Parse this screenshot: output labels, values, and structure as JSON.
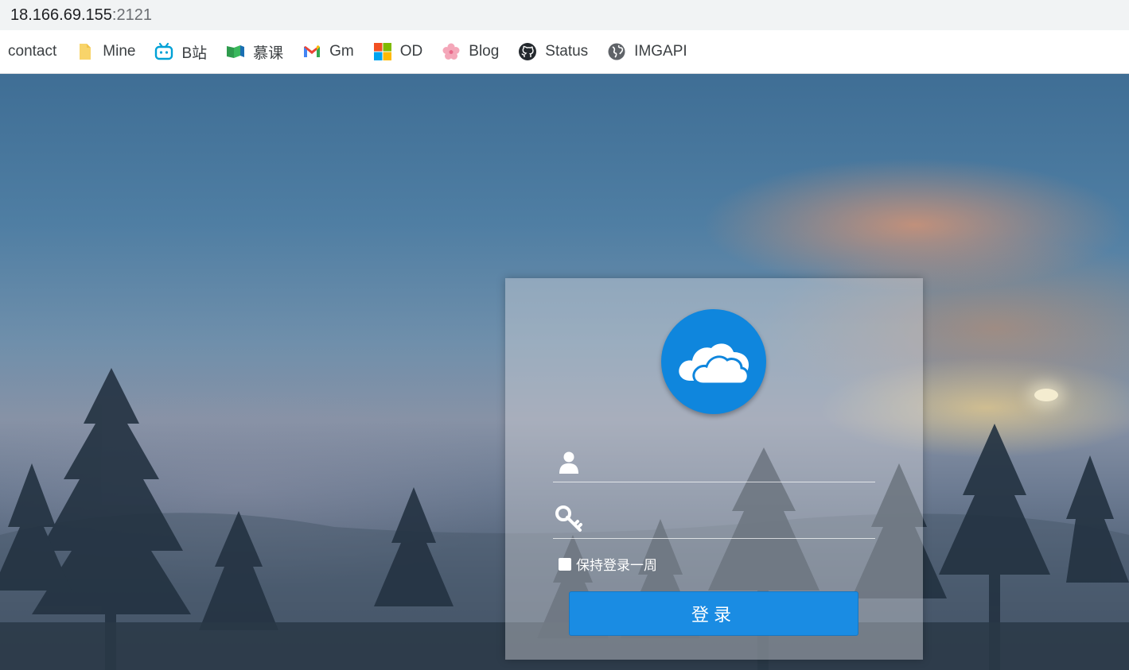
{
  "address": {
    "host": "18.166.69.155",
    "port": ":2121"
  },
  "bookmarks": [
    {
      "label": "contact",
      "icon": "none"
    },
    {
      "label": "Mine",
      "icon": "folder-icon"
    },
    {
      "label": "B站",
      "icon": "bilibili-icon"
    },
    {
      "label": "慕课",
      "icon": "book-icon"
    },
    {
      "label": "Gm",
      "icon": "gmail-icon"
    },
    {
      "label": "OD",
      "icon": "microsoft-icon"
    },
    {
      "label": "Blog",
      "icon": "flower-icon"
    },
    {
      "label": "Status",
      "icon": "github-icon"
    },
    {
      "label": "IMGAPI",
      "icon": "globe-icon"
    }
  ],
  "login": {
    "logo_icon": "cloud-icon",
    "username_icon": "user-icon",
    "password_icon": "key-icon",
    "remember_label": "保持登录一周",
    "remember_checked": false,
    "submit_label": "登录"
  },
  "colors": {
    "brand": "#0f86dd",
    "button": "#1a8ce3"
  }
}
